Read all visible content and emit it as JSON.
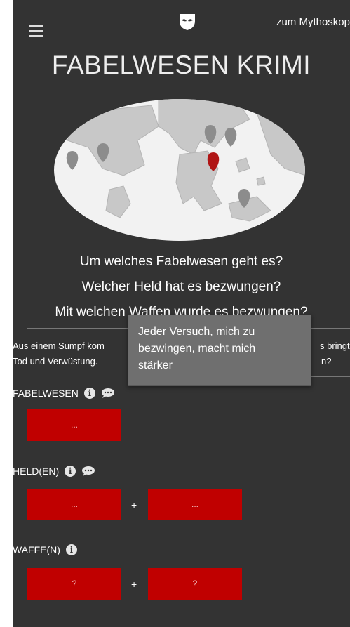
{
  "header": {
    "menu_icon": "hamburger-icon",
    "logo_icon": "mask-logo-icon",
    "link_label": "zum Mythoskop"
  },
  "title": "FABELWESEN KRIMI",
  "map": {
    "icon": "map-pin-icon",
    "pin_colors": {
      "default": "#8c8c8c",
      "active": "#b01515"
    }
  },
  "questions": [
    "Um welches Fabelwesen geht es?",
    "Welcher Held hat es bezwungen?",
    "Mit welchen Waffen wurde es bezwungen?"
  ],
  "description": {
    "line1_start": "Aus einem Sumpf kom",
    "line1_end": "s bringt",
    "line2_start": "Tod und Verwüstung.",
    "line2_end": "n?"
  },
  "tooltip": {
    "line1": "Jeder Versuch, mich zu",
    "line2": "bezwingen, macht mich",
    "line3": "stärker"
  },
  "sections": {
    "creature": {
      "label": "FABELWESEN",
      "slot1": "..."
    },
    "hero": {
      "label": "HELD(EN)",
      "slot1": "...",
      "plus": "+",
      "slot2": "..."
    },
    "weapon": {
      "label": "WAFFE(N)",
      "slot1": "?",
      "plus": "+",
      "slot2": "?"
    }
  },
  "colors": {
    "background": "#333333",
    "slot_red": "#c00000",
    "tooltip_bg": "#6f6f6f"
  }
}
